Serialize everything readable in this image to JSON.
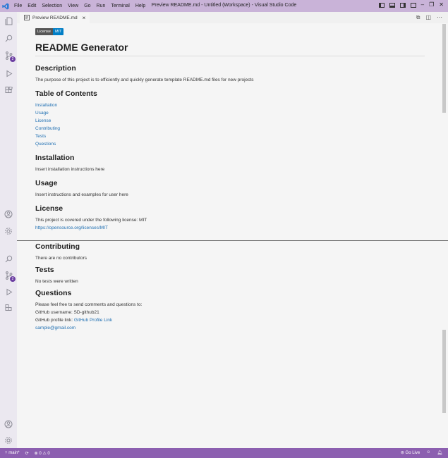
{
  "titlebar": {
    "menu": [
      "File",
      "Edit",
      "Selection",
      "View",
      "Go",
      "Run",
      "Terminal",
      "Help"
    ],
    "title": "Preview README.md - Untitled (Workspace) - Visual Studio Code"
  },
  "tab": {
    "label": "Preview README.md",
    "close": "×"
  },
  "activity": {
    "scm_badge": "2"
  },
  "preview": {
    "license_badge": {
      "left": "License",
      "right": "MIT"
    },
    "title": "README Generator",
    "description": {
      "heading": "Description",
      "text": "The purpose of this project is to efficiently and quickly generate template README.md files for new projects"
    },
    "toc": {
      "heading": "Table of Contents",
      "items": [
        "Installation",
        "Usage",
        "License",
        "Contributing",
        "Tests",
        "Questions"
      ]
    },
    "installation": {
      "heading": "Installation",
      "text": "Insert installation instructions here"
    },
    "usage": {
      "heading": "Usage",
      "text": "Insert instructions and examples for user here"
    },
    "license": {
      "heading": "License",
      "text": "This project is covered under the following license: MIT",
      "link": "https://opensource.org/licenses/MIT"
    },
    "contributing": {
      "heading": "Contributing",
      "text": "There are no contributors"
    },
    "tests": {
      "heading": "Tests",
      "text": "No tests were written"
    },
    "questions": {
      "heading": "Questions",
      "text": "Please feel free to send comments and questions to:",
      "github_username": "GitHub username: SD-github21",
      "github_profile_prefix": "GitHub profile link:",
      "github_profile_link": "GitHub Profile Link",
      "email": "sample@gmail.com"
    }
  },
  "statusbar": {
    "branch": "main*",
    "problems": "⊗ 0 ⚠ 0",
    "golive": "Go Live"
  },
  "colors": {
    "accent": "#8c5fb0",
    "titlebar": "#c9b3d8",
    "link": "#1f6fb2"
  }
}
